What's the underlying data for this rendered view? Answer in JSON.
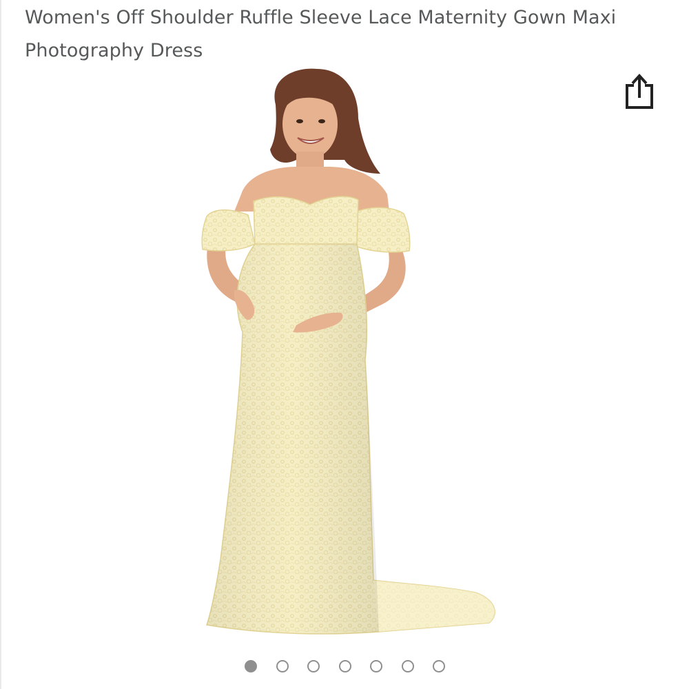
{
  "product": {
    "title": "Women's Off Shoulder Ruffle Sleeve Lace Maternity Gown Maxi Photography Dress"
  },
  "share": {
    "icon": "share-icon"
  },
  "image": {
    "subject": "product-photo",
    "dress_color": "#f6efc6",
    "lace_color": "#e9dca2",
    "skin_color": "#e7b28f",
    "hair_color": "#6e3e2a"
  },
  "carousel": {
    "count": 7,
    "active_index": 0,
    "active_color": "#8f8f8f",
    "inactive_color": "#ffffff"
  }
}
